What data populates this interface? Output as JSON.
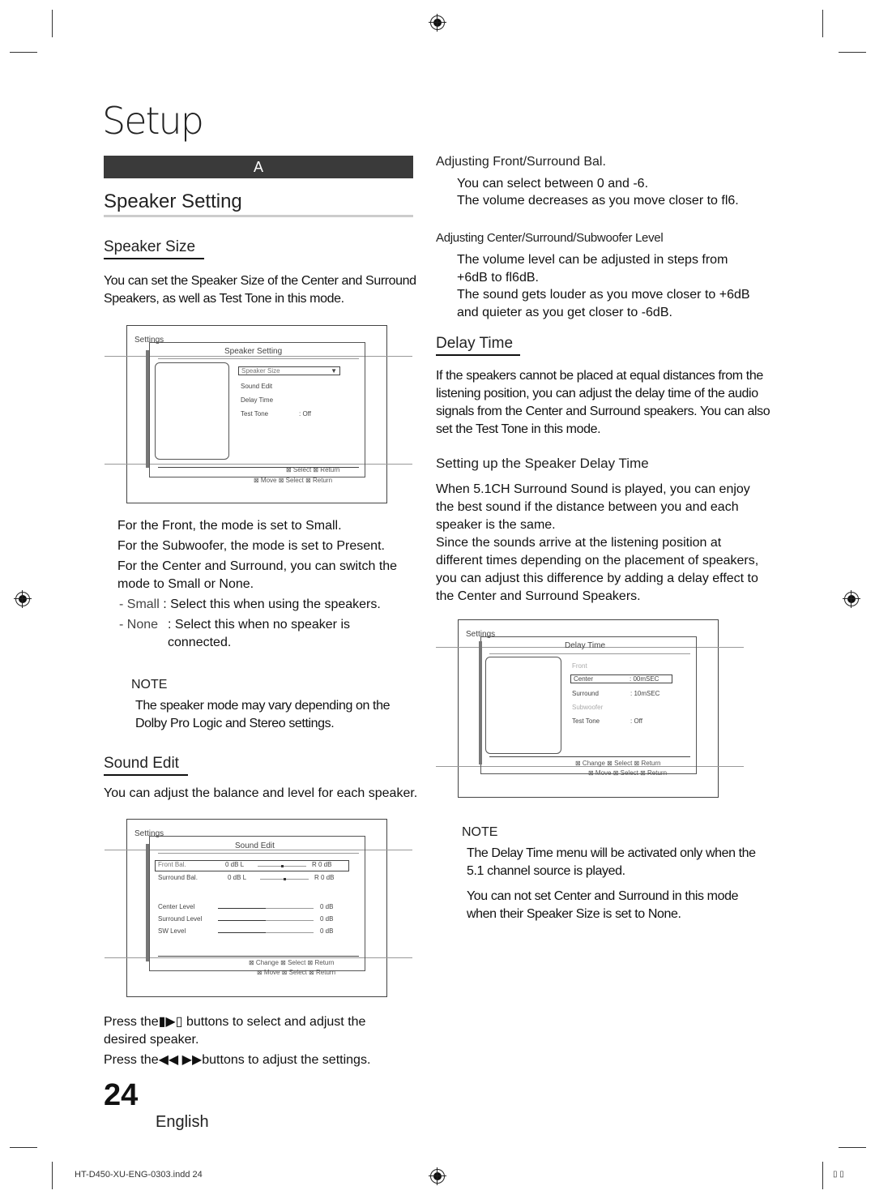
{
  "page": {
    "chapter_title": "Setup",
    "section_bar_label": "A",
    "section_title": "Speaker Setting",
    "page_number": "24",
    "language": "English",
    "footer_file": "HT-D450-XU-ENG-0303.indd   24",
    "footer_right": "▯ ▯"
  },
  "speaker_size": {
    "heading": "Speaker Size",
    "intro": "You can set the Speaker Size of the Center and Surround Speakers, as well as Test Tone in this mode.",
    "screen": {
      "settings_label": "Settings",
      "title": "Speaker Setting",
      "items": [
        {
          "label": "Speaker Size",
          "value": "",
          "selected": true,
          "arrow": "▼"
        },
        {
          "label": "Sound Edit",
          "value": ""
        },
        {
          "label": "Delay Time",
          "value": ""
        },
        {
          "label": "Test Tone",
          "value": ":  Off"
        }
      ],
      "footer_line1": "⊠  Select    ⊠  Return",
      "footer_line2": "⊠  Move    ⊠  Select    ⊠  Return"
    },
    "bullets": [
      "For the Front, the mode is set to Small.",
      "For the Subwoofer, the mode is set to Present.",
      "For the Center and Surround, you can switch the mode to Small or None."
    ],
    "options": [
      {
        "name": "- Small",
        "desc": ":  Select this when using the speakers."
      },
      {
        "name": "- None",
        "desc": ": Select this when no speaker is connected."
      }
    ],
    "note_heading": "NOTE",
    "note_text": "The speaker mode may vary depending on the Dolby Pro Logic and Stereo settings."
  },
  "sound_edit": {
    "heading": "Sound Edit",
    "intro": "You can adjust the balance and level for each speaker.",
    "screen": {
      "settings_label": "Settings",
      "title": "Sound Edit",
      "balance_rows": [
        {
          "label": "Front Bal.",
          "left": "0 dB  L",
          "right": "R  0 dB",
          "position": 0.5,
          "selected": true
        },
        {
          "label": "Surround  Bal.",
          "left": "0 dB  L",
          "right": "R  0 dB",
          "position": 0.5,
          "selected": false
        }
      ],
      "level_rows": [
        {
          "label": "Center Level",
          "value": "0 dB",
          "level": 0.5
        },
        {
          "label": "Surround Level",
          "value": "0 dB",
          "level": 0.5
        },
        {
          "label": "SW Level",
          "value": "0 dB",
          "level": 0.5
        }
      ],
      "footer_line1": "⊠  Change ⊠  Select    ⊠  Return",
      "footer_line2": "⊠  Move    ⊠  Select    ⊠  Return"
    },
    "instruction1": "Press the▮▶▯ buttons to select and adjust the desired speaker.",
    "instruction2": "Press the◀◀ ▶▶buttons to adjust the settings."
  },
  "adjusting": {
    "front_surround_heading": "Adjusting Front/Surround Bal.",
    "front_surround_lines": [
      "You can select between 0 and -6.",
      "The volume decreases as you move closer to fl6."
    ],
    "level_heading": "Adjusting Center/Surround/Subwoofer Level",
    "level_lines": [
      "The volume level can be adjusted in steps from +6dB to fl6dB.",
      "The sound gets louder as you move closer to +6dB and quieter as you get closer to -6dB."
    ]
  },
  "delay_time": {
    "heading": "Delay Time",
    "intro": "If the speakers cannot be placed at equal distances from the listening position, you can adjust the delay time of the audio signals from the Center and  Surround speakers. You can also set the Test Tone in this mode.",
    "setup_heading": "Setting up the Speaker Delay Time",
    "setup_text1": "When 5.1CH Surround Sound is played, you can enjoy the best sound if the distance between you and each speaker is the same.",
    "setup_text2": "Since the sounds arrive at the listening position at different times depending on the placement of speakers, you can adjust this difference by adding a delay effect to the Center and Surround Speakers.",
    "screen": {
      "settings_label": "Settings",
      "title": "Delay Time",
      "items": [
        {
          "label": "Front",
          "value": "",
          "dim": true
        },
        {
          "label": "Center",
          "value": ":   00mSEC",
          "selected": true
        },
        {
          "label": "Surround",
          "value": ":   10mSEC"
        },
        {
          "label": "Subwoofer",
          "value": "",
          "dim": true
        },
        {
          "label": "Test Tone",
          "value": ":   Off"
        }
      ],
      "footer_line1": "⊠  Change ⊠  Select    ⊠  Return",
      "footer_line2": "⊠  Move    ⊠  Select    ⊠  Return"
    },
    "note_heading": "NOTE",
    "note_items": [
      "The Delay Time menu will be activated only when the 5.1 channel source is played.",
      "You can not set Center and Surround in this mode when their Speaker Size is set to None."
    ]
  }
}
